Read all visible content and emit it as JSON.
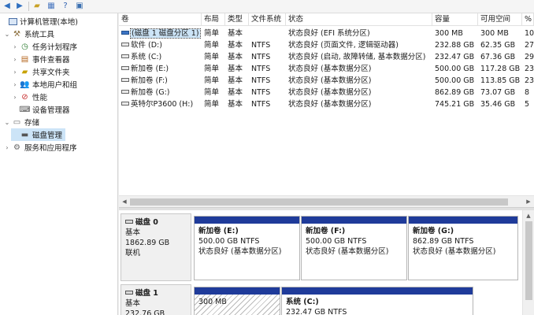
{
  "toolbar": {
    "buttons": [
      "back-arrow-icon",
      "forward-arrow-icon",
      "folder-icon",
      "properties-icon",
      "help-icon",
      "view-icon"
    ]
  },
  "tree": {
    "items": [
      {
        "label": "计算机管理(本地)",
        "icon": "computer-icon",
        "twisty": ""
      },
      {
        "label": "系统工具",
        "icon": "tools-icon",
        "twisty": "⌄"
      },
      {
        "label": "任务计划程序",
        "icon": "task-scheduler-icon",
        "twisty": "›"
      },
      {
        "label": "事件查看器",
        "icon": "event-viewer-icon",
        "twisty": "›"
      },
      {
        "label": "共享文件夹",
        "icon": "shared-folder-icon",
        "twisty": "›"
      },
      {
        "label": "本地用户和组",
        "icon": "users-icon",
        "twisty": "›"
      },
      {
        "label": "性能",
        "icon": "performance-icon",
        "twisty": "›"
      },
      {
        "label": "设备管理器",
        "icon": "device-manager-icon",
        "twisty": ""
      },
      {
        "label": "存储",
        "icon": "storage-icon",
        "twisty": "⌄"
      },
      {
        "label": "磁盘管理",
        "icon": "disk-management-icon",
        "twisty": ""
      },
      {
        "label": "服务和应用程序",
        "icon": "services-icon",
        "twisty": "›"
      }
    ]
  },
  "volume_list": {
    "columns": [
      "卷",
      "布局",
      "类型",
      "文件系统",
      "状态",
      "容量",
      "可用空间",
      "%"
    ],
    "rows": [
      {
        "name": "(磁盘 1 磁盘分区 1)",
        "layout": "简单",
        "type": "基本",
        "fs": "",
        "status": "状态良好 (EFI 系统分区)",
        "capacity": "300 MB",
        "free": "300 MB",
        "pct": "10"
      },
      {
        "name": "软件 (D:)",
        "layout": "简单",
        "type": "基本",
        "fs": "NTFS",
        "status": "状态良好 (页面文件, 逻辑驱动器)",
        "capacity": "232.88 GB",
        "free": "62.35 GB",
        "pct": "27"
      },
      {
        "name": "系统 (C:)",
        "layout": "简单",
        "type": "基本",
        "fs": "NTFS",
        "status": "状态良好 (启动, 故障转储, 基本数据分区)",
        "capacity": "232.47 GB",
        "free": "67.36 GB",
        "pct": "29"
      },
      {
        "name": "新加卷 (E:)",
        "layout": "简单",
        "type": "基本",
        "fs": "NTFS",
        "status": "状态良好 (基本数据分区)",
        "capacity": "500.00 GB",
        "free": "117.28 GB",
        "pct": "23"
      },
      {
        "name": "新加卷 (F:)",
        "layout": "简单",
        "type": "基本",
        "fs": "NTFS",
        "status": "状态良好 (基本数据分区)",
        "capacity": "500.00 GB",
        "free": "113.85 GB",
        "pct": "23"
      },
      {
        "name": "新加卷 (G:)",
        "layout": "简单",
        "type": "基本",
        "fs": "NTFS",
        "status": "状态良好 (基本数据分区)",
        "capacity": "862.89 GB",
        "free": "73.07 GB",
        "pct": "8"
      },
      {
        "name": "英特尔P3600 (H:)",
        "layout": "简单",
        "type": "基本",
        "fs": "NTFS",
        "status": "状态良好 (基本数据分区)",
        "capacity": "745.21 GB",
        "free": "35.46 GB",
        "pct": "5"
      }
    ]
  },
  "disks": [
    {
      "name": "磁盘 0",
      "type": "基本",
      "size": "1862.89 GB",
      "state": "联机",
      "partitions": [
        {
          "name": "新加卷 (E:)",
          "size": "500.00 GB NTFS",
          "status": "状态良好 (基本数据分区)"
        },
        {
          "name": "新加卷 (F:)",
          "size": "500.00 GB NTFS",
          "status": "状态良好 (基本数据分区)"
        },
        {
          "name": "新加卷 (G:)",
          "size": "862.89 GB NTFS",
          "status": "状态良好 (基本数据分区)"
        }
      ]
    },
    {
      "name": "磁盘 1",
      "type": "基本",
      "size": "232.76 GB",
      "state": "",
      "partitions": [
        {
          "name": "",
          "size": "300 MB",
          "status": ""
        },
        {
          "name": "系统 (C:)",
          "size": "232.47 GB NTFS",
          "status": ""
        }
      ]
    }
  ]
}
